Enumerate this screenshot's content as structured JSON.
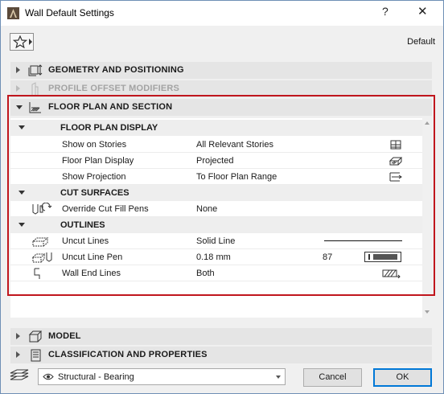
{
  "window": {
    "title": "Wall Default Settings",
    "help_label": "?",
    "close_label": "✕"
  },
  "toolbar": {
    "favorites_icon": "star-icon",
    "default_label": "Default"
  },
  "panels": {
    "geometry": {
      "label": "GEOMETRY AND POSITIONING",
      "icon": "geometry-icon"
    },
    "profile": {
      "label": "PROFILE OFFSET MODIFIERS",
      "icon": "profile-icon"
    },
    "floorplan": {
      "label": "FLOOR PLAN AND SECTION",
      "icon": "floor-plan-icon"
    },
    "model": {
      "label": "MODEL",
      "icon": "model-icon"
    },
    "classification": {
      "label": "CLASSIFICATION AND PROPERTIES",
      "icon": "classification-icon"
    }
  },
  "floor_plan_display": {
    "title": "FLOOR PLAN DISPLAY",
    "rows": [
      {
        "label": "Show on Stories",
        "value": "All Relevant Stories",
        "icon": "stories-icon"
      },
      {
        "label": "Floor Plan Display",
        "value": "Projected",
        "icon": "projected-icon"
      },
      {
        "label": "Show Projection",
        "value": "To Floor Plan Range",
        "icon": "projection-range-icon"
      }
    ]
  },
  "cut_surfaces": {
    "title": "CUT SURFACES",
    "rows": [
      {
        "label": "Override Cut Fill Pens",
        "value": "None",
        "icon": "cut-fill-pens-icon"
      }
    ]
  },
  "outlines": {
    "title": "OUTLINES",
    "rows": [
      {
        "label": "Uncut Lines",
        "value": "Solid Line",
        "icon": "uncut-lines-icon"
      },
      {
        "label": "Uncut Line Pen",
        "value": "0.18 mm",
        "pen_number": "87",
        "icon": "uncut-line-pen-icon"
      },
      {
        "label": "Wall End Lines",
        "value": "Both",
        "icon": "wall-end-lines-icon"
      }
    ]
  },
  "footer": {
    "layer_value": "Structural - Bearing",
    "cancel_label": "Cancel",
    "ok_label": "OK"
  }
}
